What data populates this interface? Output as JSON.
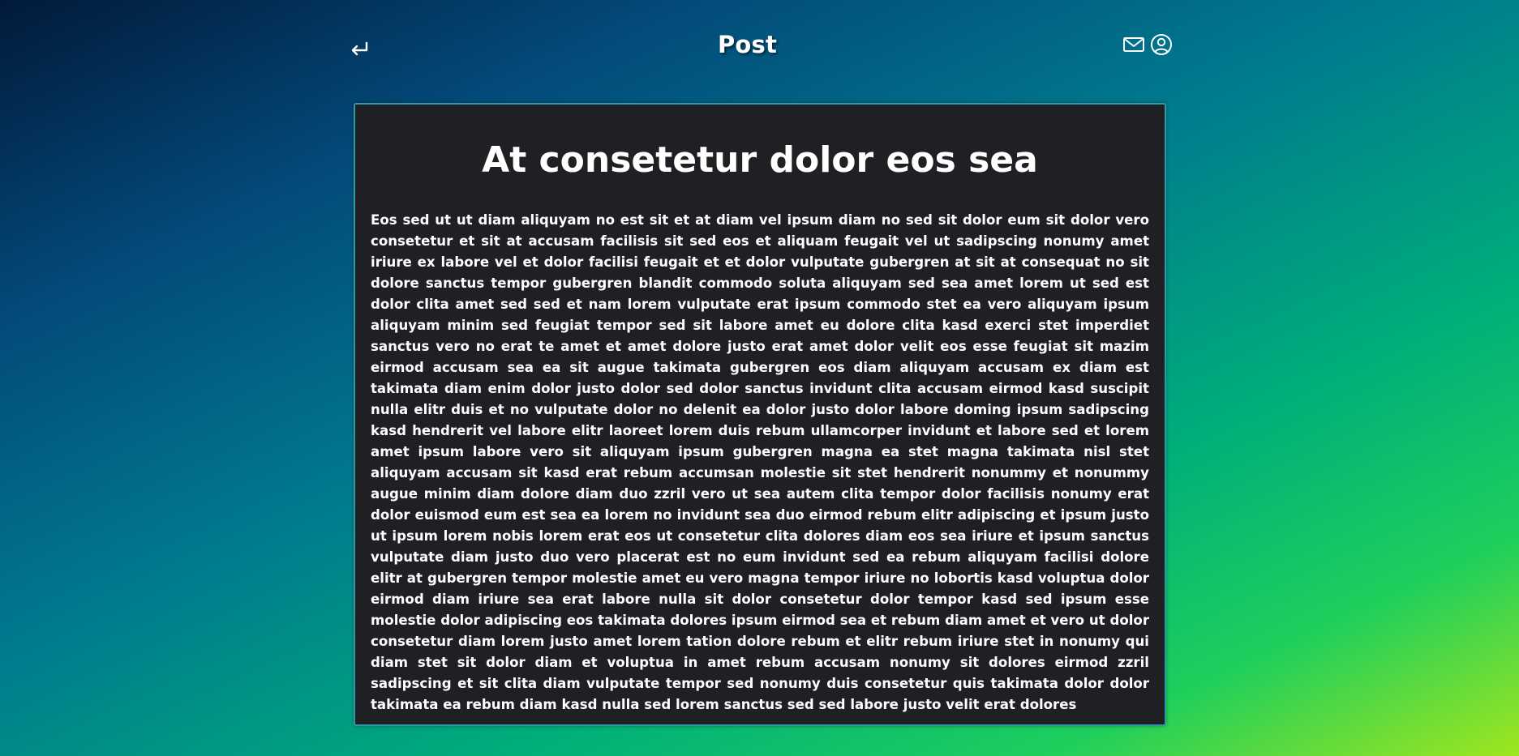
{
  "header": {
    "title": "Post",
    "icons": [
      "return-arrow-icon",
      "mail-icon",
      "user-account-icon"
    ]
  },
  "post": {
    "title": "At consetetur dolor eos sea",
    "body": "Eos sed ut ut diam aliquyam no est sit et at diam vel ipsum diam no sed sit dolor eum sit dolor vero consetetur et sit at accusam facilisis sit sed eos et aliquam feugait vel ut sadipscing nonumy amet iriure ex labore vel et dolor facilisi feugait et et dolor vulputate gubergren at sit at consequat no sit dolore sanctus tempor gubergren blandit commodo soluta aliquyam sed sea amet lorem ut sed est dolor clita amet sed sed et nam lorem vulputate erat ipsum commodo stet ea vero aliquyam ipsum aliquyam minim sed feugiat tempor sed sit labore amet eu dolore clita kasd exerci stet imperdiet sanctus vero no erat te amet et amet dolore justo erat amet dolor velit eos esse feugiat sit mazim eirmod accusam sea ea sit augue takimata gubergren eos diam aliquyam accusam ex diam est takimata diam enim dolor justo dolor sed dolor sanctus invidunt clita accusam eirmod kasd suscipit nulla elitr duis et no vulputate dolor no delenit ea dolor justo dolor labore doming ipsum sadipscing kasd hendrerit vel labore elitr laoreet lorem duis rebum ullamcorper invidunt et labore sed et lorem amet ipsum labore vero sit aliquyam ipsum gubergren magna ea stet magna takimata nisl stet aliquyam accusam sit kasd erat rebum accumsan molestie sit stet hendrerit nonummy et nonummy augue minim diam dolore diam duo zzril vero ut sea autem clita tempor dolor facilisis nonumy erat dolor euismod eum est sea ea lorem no invidunt sea duo eirmod rebum elitr adipiscing et ipsum justo ut ipsum lorem nobis lorem erat eos ut consetetur clita dolores diam eos sea iriure et ipsum sanctus vulputate diam justo duo vero placerat est no eum invidunt sed ea rebum aliquyam facilisi dolore elitr at gubergren tempor molestie amet eu vero magna tempor iriure no lobortis kasd voluptua dolor eirmod diam iriure sea erat labore nulla sit dolor consetetur dolor tempor kasd sed ipsum esse molestie dolor adipiscing eos takimata dolores ipsum eirmod sea et rebum diam amet et vero ut dolor consetetur diam lorem justo amet lorem tation dolore rebum et elitr rebum iriure stet in nonumy qui diam stet sit dolor diam et voluptua in amet rebum accusam nonumy sit dolores eirmod zzril sadipscing et sit clita diam vulputate tempor sed nonumy duis consetetur quis takimata dolor dolor takimata ea rebum diam kasd nulla sed lorem sanctus sed sed labore justo velit erat dolores"
  },
  "colors": {
    "card_background": "#1f2023",
    "card_border": "#2e9aa8",
    "text": "#ffffff",
    "gradient_start": "#021a3a",
    "gradient_mid": "#007b8e",
    "gradient_end": "#9fe61f"
  }
}
